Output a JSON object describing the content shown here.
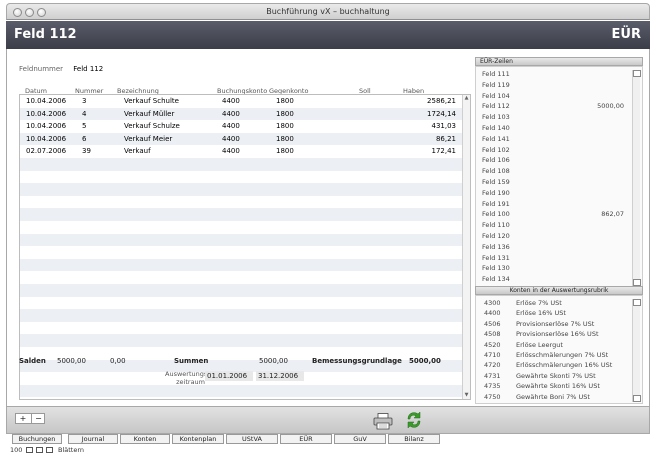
{
  "window": {
    "title": "Buchführung vX – buchhaltung"
  },
  "header": {
    "title": "Feld 112",
    "right": "EÜR"
  },
  "fieldnumber": {
    "label": "Feldnummer",
    "value": "Feld 112"
  },
  "table": {
    "columns": [
      "Datum",
      "Nummer",
      "Bezeichnung",
      "Buchungskonto",
      "Gegenkonto",
      "Soll",
      "Haben"
    ],
    "rows": [
      [
        "10.04.2006",
        "3",
        "Verkauf Schulte",
        "4400",
        "1800",
        "",
        "2586,21"
      ],
      [
        "10.04.2006",
        "4",
        "Verkauf Müller",
        "4400",
        "1800",
        "",
        "1724,14"
      ],
      [
        "10.04.2006",
        "5",
        "Verkauf Schulze",
        "4400",
        "1800",
        "",
        "431,03"
      ],
      [
        "10.04.2006",
        "6",
        "Verkauf Meier",
        "4400",
        "1800",
        "",
        "86,21"
      ],
      [
        "02.07.2006",
        "39",
        "Verkauf",
        "4400",
        "1800",
        "",
        "172,41"
      ]
    ]
  },
  "summary": {
    "salden_label": "Salden",
    "salden_value1": "5000,00",
    "salden_value2": "0,00",
    "summen_label": "Summen",
    "summen_value": "5000,00",
    "bemessung_label": "Bemessungsgrundlage",
    "bemessung_value": "5000,00",
    "eval_label1": "Auswertungs-",
    "eval_label2": "zeitraum",
    "date_from": "01.01.2006",
    "date_to": "31.12.2006"
  },
  "euer_panel": {
    "title": "EÜR-Zeilen",
    "items": [
      {
        "label": "Feld 111",
        "value": ""
      },
      {
        "label": "Feld 119",
        "value": ""
      },
      {
        "label": "Feld 104",
        "value": ""
      },
      {
        "label": "Feld 112",
        "value": "5000,00"
      },
      {
        "label": "Feld 103",
        "value": ""
      },
      {
        "label": "Feld 140",
        "value": ""
      },
      {
        "label": "Feld 141",
        "value": ""
      },
      {
        "label": "Feld 102",
        "value": ""
      },
      {
        "label": "Feld 106",
        "value": ""
      },
      {
        "label": "Feld 108",
        "value": ""
      },
      {
        "label": "Feld 159",
        "value": ""
      },
      {
        "label": "Feld 190",
        "value": ""
      },
      {
        "label": "Feld 191",
        "value": ""
      },
      {
        "label": "Feld 100",
        "value": "862,07"
      },
      {
        "label": "Feld 110",
        "value": ""
      },
      {
        "label": "Feld 120",
        "value": ""
      },
      {
        "label": "Feld 136",
        "value": ""
      },
      {
        "label": "Feld 131",
        "value": ""
      },
      {
        "label": "Feld 130",
        "value": ""
      },
      {
        "label": "Feld 134",
        "value": ""
      }
    ]
  },
  "konten_panel": {
    "title": "Konten in der Auswertungsrubrik",
    "items": [
      {
        "code": "4300",
        "name": "Erlöse 7% USt"
      },
      {
        "code": "4400",
        "name": "Erlöse 16% USt"
      },
      {
        "code": "4506",
        "name": "Provisionserlöse 7% USt"
      },
      {
        "code": "4508",
        "name": "Provisionserlöse 16% USt"
      },
      {
        "code": "4520",
        "name": "Erlöse Leergut"
      },
      {
        "code": "4710",
        "name": "Erlösschmälerungen 7% USt"
      },
      {
        "code": "4720",
        "name": "Erlösschmälerungen 16% USt"
      },
      {
        "code": "4731",
        "name": "Gewährte Skonti 7% USt"
      },
      {
        "code": "4735",
        "name": "Gewährte Skonti 16% USt"
      },
      {
        "code": "4750",
        "name": "Gewährte Boni 7% USt"
      }
    ]
  },
  "toolbar": {
    "plus": "+",
    "minus": "−"
  },
  "tabs": [
    "Buchungen",
    "Journal",
    "Konten",
    "Kontenplan",
    "UStVA",
    "EÜR",
    "GuV",
    "Bilanz"
  ],
  "status": {
    "zoom": "100",
    "label": "Blättern"
  },
  "icons": {
    "print": "printer-icon",
    "sync": "sync-icon"
  }
}
